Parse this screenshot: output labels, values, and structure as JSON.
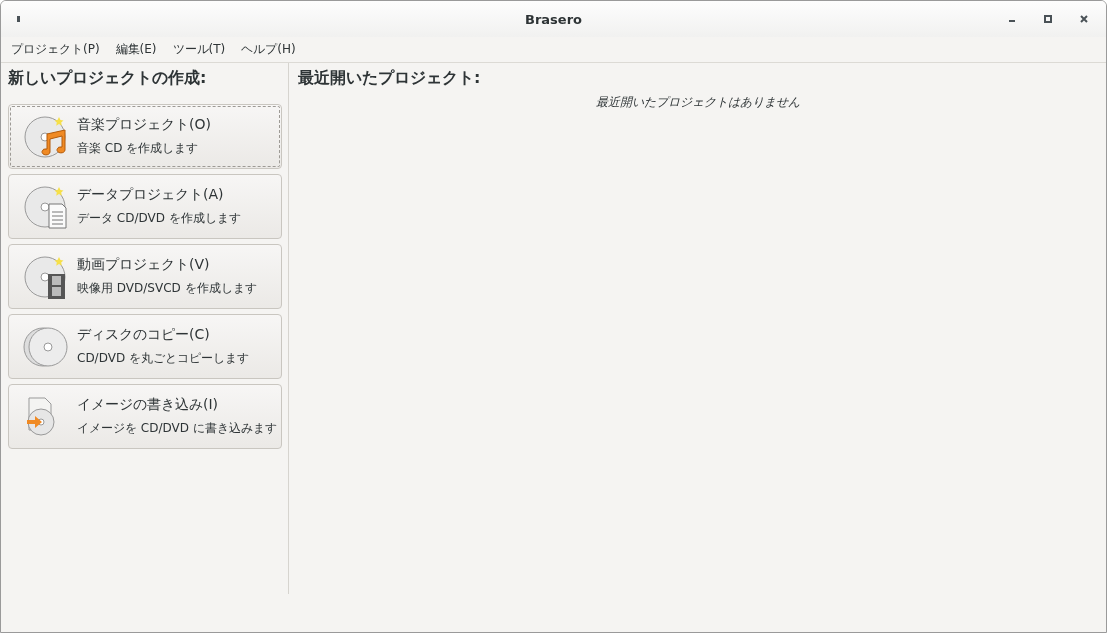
{
  "window": {
    "title": "Brasero"
  },
  "menu": [
    "プロジェクト(P)",
    "編集(E)",
    "ツール(T)",
    "ヘルプ(H)"
  ],
  "new_project": {
    "heading": "新しいプロジェクトの作成:",
    "items": [
      {
        "kind": "audio",
        "title": "音楽プロジェクト(O)",
        "description": "音楽 CD を作成します",
        "focused": true
      },
      {
        "kind": "data",
        "title": "データプロジェクト(A)",
        "description": "データ CD/DVD を作成します",
        "focused": false
      },
      {
        "kind": "video",
        "title": "動画プロジェクト(V)",
        "description": "映像用 DVD/SVCD を作成します",
        "focused": false
      },
      {
        "kind": "copy",
        "title": "ディスクのコピー(C)",
        "description": "CD/DVD を丸ごとコピーします",
        "focused": false
      },
      {
        "kind": "image",
        "title": "イメージの書き込み(I)",
        "description": "イメージを CD/DVD に書き込みます",
        "focused": false
      }
    ]
  },
  "recent": {
    "heading": "最近開いたプロジェクト:",
    "empty_text": "最近開いたプロジェクトはありません"
  }
}
